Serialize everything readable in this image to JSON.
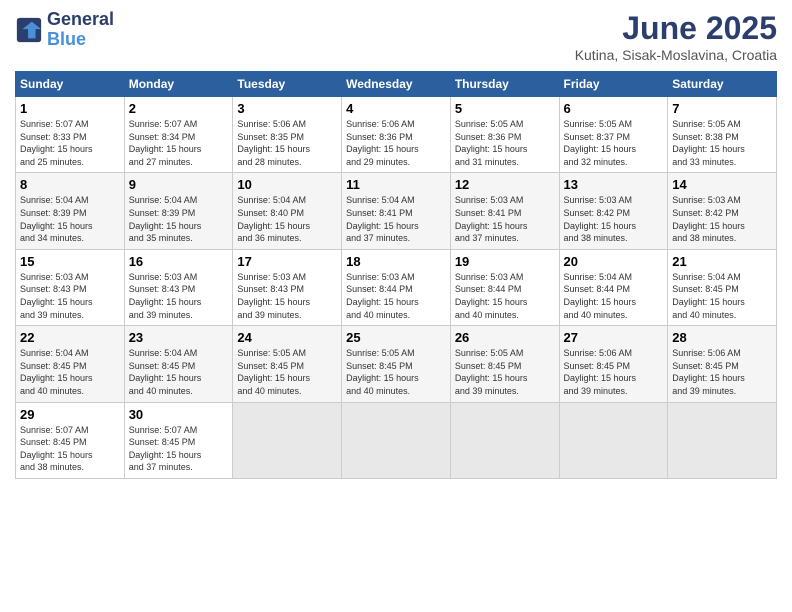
{
  "header": {
    "logo_line1": "General",
    "logo_line2": "Blue",
    "month": "June 2025",
    "location": "Kutina, Sisak-Moslavina, Croatia"
  },
  "weekdays": [
    "Sunday",
    "Monday",
    "Tuesday",
    "Wednesday",
    "Thursday",
    "Friday",
    "Saturday"
  ],
  "weeks": [
    [
      {
        "day": "1",
        "info": "Sunrise: 5:07 AM\nSunset: 8:33 PM\nDaylight: 15 hours\nand 25 minutes."
      },
      {
        "day": "2",
        "info": "Sunrise: 5:07 AM\nSunset: 8:34 PM\nDaylight: 15 hours\nand 27 minutes."
      },
      {
        "day": "3",
        "info": "Sunrise: 5:06 AM\nSunset: 8:35 PM\nDaylight: 15 hours\nand 28 minutes."
      },
      {
        "day": "4",
        "info": "Sunrise: 5:06 AM\nSunset: 8:36 PM\nDaylight: 15 hours\nand 29 minutes."
      },
      {
        "day": "5",
        "info": "Sunrise: 5:05 AM\nSunset: 8:36 PM\nDaylight: 15 hours\nand 31 minutes."
      },
      {
        "day": "6",
        "info": "Sunrise: 5:05 AM\nSunset: 8:37 PM\nDaylight: 15 hours\nand 32 minutes."
      },
      {
        "day": "7",
        "info": "Sunrise: 5:05 AM\nSunset: 8:38 PM\nDaylight: 15 hours\nand 33 minutes."
      }
    ],
    [
      {
        "day": "8",
        "info": "Sunrise: 5:04 AM\nSunset: 8:39 PM\nDaylight: 15 hours\nand 34 minutes."
      },
      {
        "day": "9",
        "info": "Sunrise: 5:04 AM\nSunset: 8:39 PM\nDaylight: 15 hours\nand 35 minutes."
      },
      {
        "day": "10",
        "info": "Sunrise: 5:04 AM\nSunset: 8:40 PM\nDaylight: 15 hours\nand 36 minutes."
      },
      {
        "day": "11",
        "info": "Sunrise: 5:04 AM\nSunset: 8:41 PM\nDaylight: 15 hours\nand 37 minutes."
      },
      {
        "day": "12",
        "info": "Sunrise: 5:03 AM\nSunset: 8:41 PM\nDaylight: 15 hours\nand 37 minutes."
      },
      {
        "day": "13",
        "info": "Sunrise: 5:03 AM\nSunset: 8:42 PM\nDaylight: 15 hours\nand 38 minutes."
      },
      {
        "day": "14",
        "info": "Sunrise: 5:03 AM\nSunset: 8:42 PM\nDaylight: 15 hours\nand 38 minutes."
      }
    ],
    [
      {
        "day": "15",
        "info": "Sunrise: 5:03 AM\nSunset: 8:43 PM\nDaylight: 15 hours\nand 39 minutes."
      },
      {
        "day": "16",
        "info": "Sunrise: 5:03 AM\nSunset: 8:43 PM\nDaylight: 15 hours\nand 39 minutes."
      },
      {
        "day": "17",
        "info": "Sunrise: 5:03 AM\nSunset: 8:43 PM\nDaylight: 15 hours\nand 39 minutes."
      },
      {
        "day": "18",
        "info": "Sunrise: 5:03 AM\nSunset: 8:44 PM\nDaylight: 15 hours\nand 40 minutes."
      },
      {
        "day": "19",
        "info": "Sunrise: 5:03 AM\nSunset: 8:44 PM\nDaylight: 15 hours\nand 40 minutes."
      },
      {
        "day": "20",
        "info": "Sunrise: 5:04 AM\nSunset: 8:44 PM\nDaylight: 15 hours\nand 40 minutes."
      },
      {
        "day": "21",
        "info": "Sunrise: 5:04 AM\nSunset: 8:45 PM\nDaylight: 15 hours\nand 40 minutes."
      }
    ],
    [
      {
        "day": "22",
        "info": "Sunrise: 5:04 AM\nSunset: 8:45 PM\nDaylight: 15 hours\nand 40 minutes."
      },
      {
        "day": "23",
        "info": "Sunrise: 5:04 AM\nSunset: 8:45 PM\nDaylight: 15 hours\nand 40 minutes."
      },
      {
        "day": "24",
        "info": "Sunrise: 5:05 AM\nSunset: 8:45 PM\nDaylight: 15 hours\nand 40 minutes."
      },
      {
        "day": "25",
        "info": "Sunrise: 5:05 AM\nSunset: 8:45 PM\nDaylight: 15 hours\nand 40 minutes."
      },
      {
        "day": "26",
        "info": "Sunrise: 5:05 AM\nSunset: 8:45 PM\nDaylight: 15 hours\nand 39 minutes."
      },
      {
        "day": "27",
        "info": "Sunrise: 5:06 AM\nSunset: 8:45 PM\nDaylight: 15 hours\nand 39 minutes."
      },
      {
        "day": "28",
        "info": "Sunrise: 5:06 AM\nSunset: 8:45 PM\nDaylight: 15 hours\nand 39 minutes."
      }
    ],
    [
      {
        "day": "29",
        "info": "Sunrise: 5:07 AM\nSunset: 8:45 PM\nDaylight: 15 hours\nand 38 minutes."
      },
      {
        "day": "30",
        "info": "Sunrise: 5:07 AM\nSunset: 8:45 PM\nDaylight: 15 hours\nand 37 minutes."
      },
      null,
      null,
      null,
      null,
      null
    ]
  ]
}
